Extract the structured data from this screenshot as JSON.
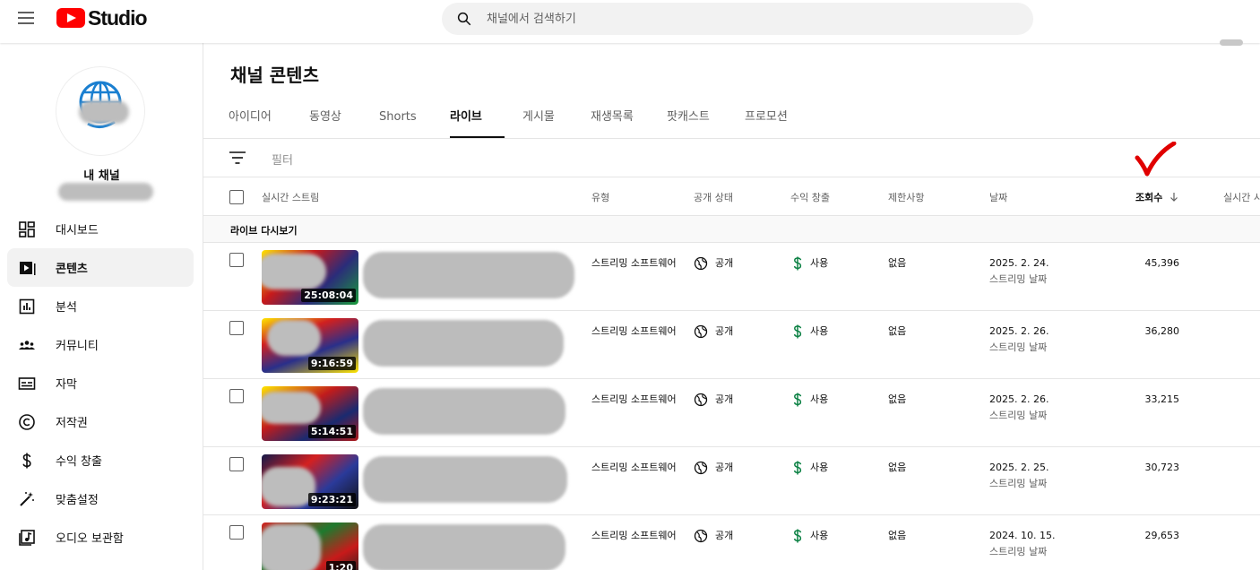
{
  "header": {
    "logo_text": "Studio",
    "search_placeholder": "채널에서 검색하기"
  },
  "sidebar": {
    "channel_label": "내 채널",
    "items": [
      {
        "label": "대시보드",
        "icon": "dashboard-icon"
      },
      {
        "label": "콘텐츠",
        "icon": "content-icon",
        "active": true
      },
      {
        "label": "분석",
        "icon": "analytics-icon"
      },
      {
        "label": "커뮤니티",
        "icon": "community-icon"
      },
      {
        "label": "자막",
        "icon": "subtitles-icon"
      },
      {
        "label": "저작권",
        "icon": "copyright-icon"
      },
      {
        "label": "수익 창출",
        "icon": "dollar-icon"
      },
      {
        "label": "맞춤설정",
        "icon": "customization-icon"
      },
      {
        "label": "오디오 보관함",
        "icon": "audio-library-icon"
      }
    ]
  },
  "main": {
    "title": "채널 콘텐츠",
    "tabs": [
      {
        "label": "아이디어"
      },
      {
        "label": "동영상"
      },
      {
        "label": "Shorts"
      },
      {
        "label": "라이브",
        "active": true
      },
      {
        "label": "게시물"
      },
      {
        "label": "재생목록"
      },
      {
        "label": "팟캐스트"
      },
      {
        "label": "프로모션"
      }
    ],
    "filter_label": "필터",
    "columns": {
      "stream": "실시간 스트림",
      "type": "유형",
      "visibility": "공개 상태",
      "monetization": "수익 창출",
      "restrictions": "제한사항",
      "date": "날짜",
      "views": "조회수",
      "live": "실시간 시"
    },
    "section_label": "라이브 다시보기",
    "rows": [
      {
        "duration": "25:08:04",
        "type": "스트리밍 소프트웨어",
        "visibility": "공개",
        "monetization": "사용",
        "restrictions": "없음",
        "date": "2025. 2. 24.",
        "date_sub": "스트리밍 날짜",
        "views": "45,396"
      },
      {
        "duration": "9:16:59",
        "type": "스트리밍 소프트웨어",
        "visibility": "공개",
        "monetization": "사용",
        "restrictions": "없음",
        "date": "2025. 2. 26.",
        "date_sub": "스트리밍 날짜",
        "views": "36,280"
      },
      {
        "duration": "5:14:51",
        "type": "스트리밍 소프트웨어",
        "visibility": "공개",
        "monetization": "사용",
        "restrictions": "없음",
        "date": "2025. 2. 26.",
        "date_sub": "스트리밍 날짜",
        "views": "33,215"
      },
      {
        "duration": "9:23:21",
        "type": "스트리밍 소프트웨어",
        "visibility": "공개",
        "monetization": "사용",
        "restrictions": "없음",
        "date": "2025. 2. 25.",
        "date_sub": "스트리밍 날짜",
        "views": "30,723"
      },
      {
        "duration": "1:20",
        "type": "스트리밍 소프트웨어",
        "visibility": "공개",
        "monetization": "사용",
        "restrictions": "없음",
        "date": "2024. 10. 15.",
        "date_sub": "스트리밍 날짜",
        "views": "29,653"
      }
    ]
  },
  "colors": {
    "brand_red": "#ff0000",
    "money_green": "#0b8043",
    "annotation_red": "#e00000"
  }
}
